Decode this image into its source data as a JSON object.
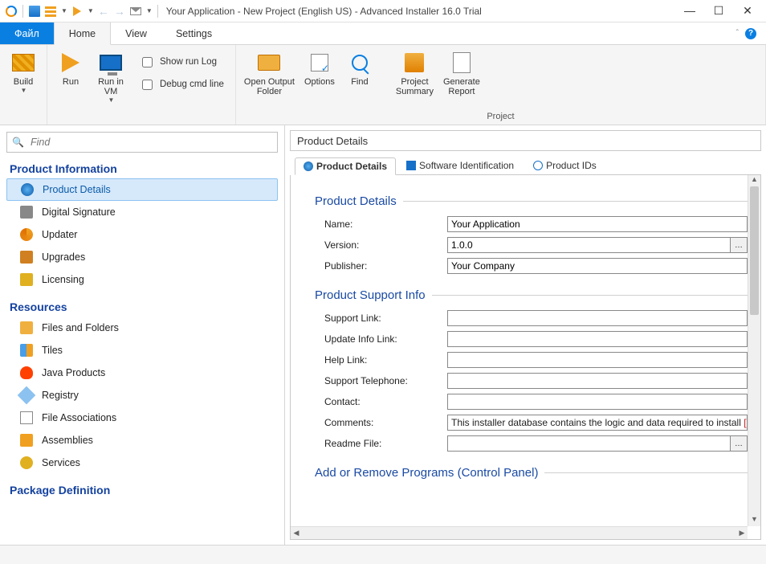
{
  "titlebar": {
    "text": "Your Application - New Project (English US) - Advanced Installer 16.0 Trial"
  },
  "menubar": {
    "file": "Файл",
    "home": "Home",
    "view": "View",
    "settings": "Settings"
  },
  "ribbon": {
    "build": "Build",
    "run": "Run",
    "run_vm": "Run in\nVM",
    "show_log": "Show run Log",
    "debug_cmd": "Debug cmd line",
    "open_output": "Open Output\nFolder",
    "options": "Options",
    "find": "Find",
    "summary": "Project\nSummary",
    "report": "Generate\nReport",
    "group_project": "Project"
  },
  "find": {
    "placeholder": "Find"
  },
  "sidebar": {
    "h_product": "Product Information",
    "items_product": [
      "Product Details",
      "Digital Signature",
      "Updater",
      "Upgrades",
      "Licensing"
    ],
    "h_resources": "Resources",
    "items_resources": [
      "Files and Folders",
      "Tiles",
      "Java Products",
      "Registry",
      "File Associations",
      "Assemblies",
      "Services"
    ],
    "h_package": "Package Definition"
  },
  "panel": {
    "header": "Product Details",
    "tabs": {
      "t1": "Product Details",
      "t2": "Software Identification",
      "t3": "Product IDs"
    }
  },
  "form": {
    "s_details": "Product Details",
    "name_l": "Name:",
    "name_v": "Your Application",
    "version_l": "Version:",
    "version_v": "1.0.0",
    "publisher_l": "Publisher:",
    "publisher_v": "Your Company",
    "s_support": "Product Support Info",
    "support_link_l": "Support Link:",
    "support_link_v": "",
    "update_link_l": "Update Info Link:",
    "update_link_v": "",
    "help_link_l": "Help Link:",
    "help_link_v": "",
    "telephone_l": "Support Telephone:",
    "telephone_v": "",
    "contact_l": "Contact:",
    "contact_v": "",
    "comments_l": "Comments:",
    "comments_v": "This installer database contains the logic and data required to install ",
    "comments_red": "[|Pro",
    "readme_l": "Readme File:",
    "readme_v": "",
    "s_arp": "Add or Remove Programs (Control Panel)"
  }
}
